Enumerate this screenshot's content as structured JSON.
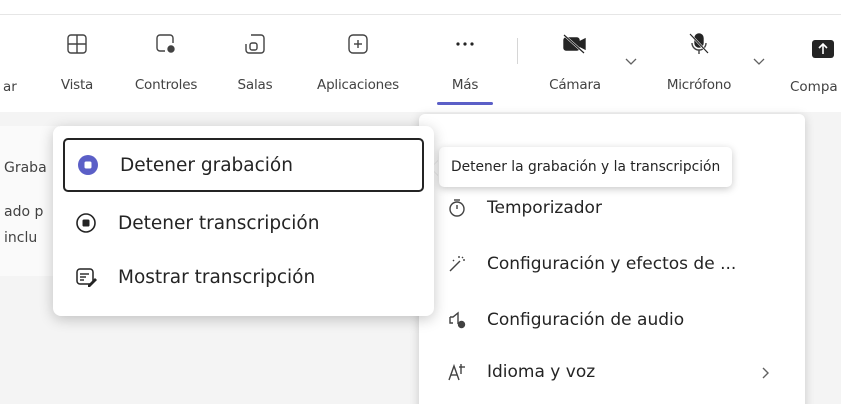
{
  "toolbar": {
    "partial_left": "ar",
    "items": [
      {
        "label": "Vista",
        "icon": "grid-icon"
      },
      {
        "label": "Controles",
        "icon": "shield-gear-icon"
      },
      {
        "label": "Salas",
        "icon": "breakout-rooms-icon"
      },
      {
        "label": "Aplicaciones",
        "icon": "add-app-icon"
      },
      {
        "label": "Más",
        "icon": "more-icon"
      },
      {
        "label": "Cámara",
        "icon": "camera-off-icon"
      },
      {
        "label": "Micrófono",
        "icon": "mic-off-icon"
      }
    ],
    "partial_right": "Compa",
    "active_color": "#5b5fc7"
  },
  "background": {
    "line1": "Graba",
    "line2": "ado p",
    "line3": "inclu"
  },
  "recording_menu": {
    "items": [
      {
        "label": "Detener grabación",
        "icon": "stop-record-icon",
        "selected": true
      },
      {
        "label": "Detener transcripción",
        "icon": "stop-transcription-icon",
        "selected": false
      },
      {
        "label": "Mostrar transcripción",
        "icon": "transcript-icon",
        "selected": false
      }
    ],
    "accent": "#5b5fc7"
  },
  "tooltip": {
    "text": "Detener la grabación y la transcripción"
  },
  "more_menu": {
    "items": [
      {
        "label": "Temporizador",
        "icon": "timer-icon"
      },
      {
        "label": "Configuración y efectos de ...",
        "icon": "effects-wand-icon"
      },
      {
        "label": "Configuración de audio",
        "icon": "speaker-gear-icon"
      },
      {
        "label": "Idioma y voz",
        "icon": "language-icon",
        "has_submenu": true
      }
    ]
  }
}
